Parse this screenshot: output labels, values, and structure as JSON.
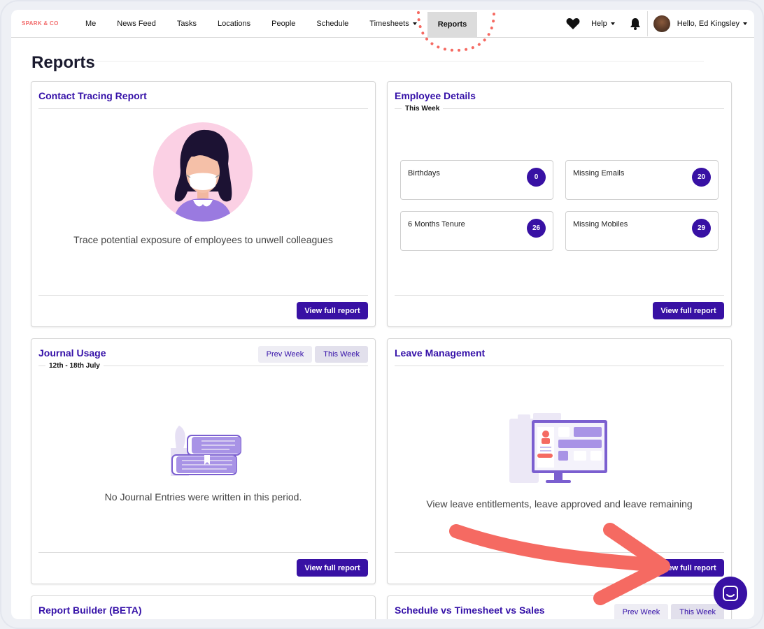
{
  "nav": {
    "brand": "SPARK & CO",
    "items": [
      {
        "label": "Me"
      },
      {
        "label": "News Feed"
      },
      {
        "label": "Tasks"
      },
      {
        "label": "Locations"
      },
      {
        "label": "People"
      },
      {
        "label": "Schedule"
      },
      {
        "label": "Timesheets"
      },
      {
        "label": "Reports"
      }
    ],
    "help_label": "Help",
    "greeting": "Hello, Ed Kingsley"
  },
  "page": {
    "title": "Reports"
  },
  "cards": {
    "contact_tracing": {
      "title": "Contact Tracing Report",
      "description": "Trace potential exposure of employees to unwell colleagues",
      "button": "View full report"
    },
    "employee_details": {
      "title": "Employee Details",
      "period": "This Week",
      "stats": [
        {
          "label": "Birthdays",
          "value": "0"
        },
        {
          "label": "Missing Emails",
          "value": "20"
        },
        {
          "label": "6 Months Tenure",
          "value": "26"
        },
        {
          "label": "Missing Mobiles",
          "value": "29"
        }
      ],
      "button": "View full report"
    },
    "journal_usage": {
      "title": "Journal Usage",
      "period": "12th - 18th July",
      "prev_week": "Prev Week",
      "this_week": "This Week",
      "empty_text": "No Journal Entries were written in this period.",
      "button": "View full report"
    },
    "leave_management": {
      "title": "Leave Management",
      "description": "View leave entitlements, leave approved and leave remaining",
      "button": "View full report"
    },
    "report_builder": {
      "title": "Report Builder (BETA)"
    },
    "schedule_vs_timesheet": {
      "title": "Schedule vs Timesheet vs Sales",
      "prev_week": "Prev Week",
      "this_week": "This Week"
    }
  },
  "colors": {
    "accent": "#3811a4",
    "title": "#3511a8",
    "brand": "#f26b6b",
    "annotation": "#f56a62"
  }
}
